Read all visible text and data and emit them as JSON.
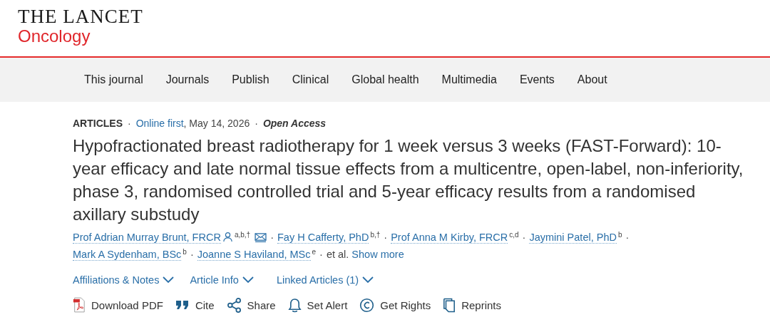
{
  "logo": {
    "title": "THE LANCET",
    "subtitle": "Oncology"
  },
  "nav": [
    {
      "label": "This journal"
    },
    {
      "label": "Journals"
    },
    {
      "label": "Publish"
    },
    {
      "label": "Clinical"
    },
    {
      "label": "Global health"
    },
    {
      "label": "Multimedia"
    },
    {
      "label": "Events"
    },
    {
      "label": "About"
    }
  ],
  "meta": [
    {
      "kind": "category",
      "text": "ARTICLES"
    },
    {
      "kind": "separator",
      "text": "·"
    },
    {
      "kind": "link",
      "text": "Online first"
    },
    {
      "kind": "text",
      "text": ", May 14, 2026"
    },
    {
      "kind": "separator",
      "text": "·"
    },
    {
      "kind": "access",
      "text": "Open Access"
    }
  ],
  "title": "Hypofractionated breast radiotherapy for 1 week versus 3 weeks (FAST-Forward): 10-year efficacy and late normal tissue effects from a multicentre, open-label, non-inferiority, phase 3, randomised controlled trial and 5-year efficacy results from a randomised axillary substudy",
  "authors": [
    {
      "name": "Prof Adrian Murray Brunt, FRCR",
      "corresponding": true,
      "affiliations": "a,b,†",
      "separator": "·"
    },
    {
      "name": "Fay H Cafferty, PhD",
      "corresponding": false,
      "affiliations": "b,†",
      "separator": "·"
    },
    {
      "name": "Prof Anna M Kirby, FRCR",
      "corresponding": false,
      "affiliations": "c,d",
      "separator": "·"
    },
    {
      "name": "Jaymini Patel, PhD",
      "corresponding": false,
      "affiliations": "b",
      "separator": "·"
    },
    {
      "name": "Mark A Sydenham, BSc",
      "corresponding": false,
      "affiliations": "b",
      "separator": "·"
    },
    {
      "name": "Joanne S Haviland, MSc",
      "corresponding": false,
      "affiliations": "e",
      "separator": "·"
    }
  ],
  "et_al": "et al.",
  "show_more": "Show more",
  "expanders": [
    {
      "label": "Affiliations & Notes",
      "expanded": false
    },
    {
      "label": "Article Info",
      "expanded": false
    },
    {
      "label": "Linked Articles (1)",
      "expanded": false
    }
  ],
  "actions": [
    {
      "kind": "pdf",
      "label": "Download PDF"
    },
    {
      "kind": "cite",
      "label": "Cite"
    },
    {
      "kind": "share",
      "label": "Share"
    },
    {
      "kind": "alert",
      "label": "Set Alert"
    },
    {
      "kind": "rights",
      "label": "Get Rights"
    },
    {
      "kind": "reprints",
      "label": "Reprints"
    }
  ]
}
